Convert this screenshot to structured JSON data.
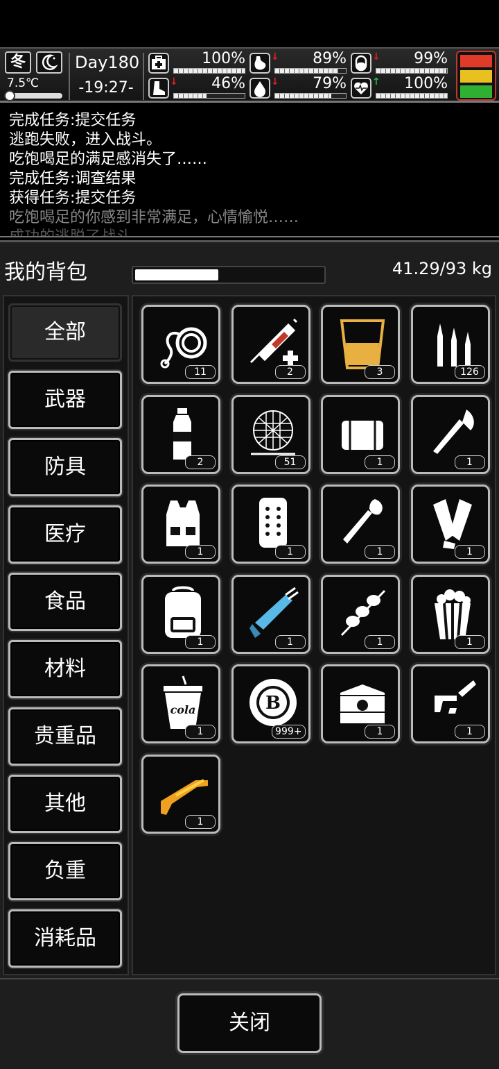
{
  "status": {
    "season": "冬",
    "temperature": "7.5℃",
    "day": "Day180",
    "time": "-19:27-",
    "stats": [
      {
        "name": "health",
        "icon": "medkit-icon",
        "value": "100%",
        "fill": 100,
        "trend": ""
      },
      {
        "name": "hunger",
        "icon": "stomach-icon",
        "value": "89%",
        "fill": 89,
        "trend": "down"
      },
      {
        "name": "medicine",
        "icon": "pill-icon",
        "value": "99%",
        "fill": 99,
        "trend": "down"
      },
      {
        "name": "stamina",
        "icon": "boot-icon",
        "value": "46%",
        "fill": 46,
        "trend": "down"
      },
      {
        "name": "thirst",
        "icon": "water-drop-icon",
        "value": "79%",
        "fill": 79,
        "trend": "down"
      },
      {
        "name": "mood",
        "icon": "heart-icon",
        "value": "100%",
        "fill": 100,
        "trend": "up"
      }
    ],
    "signal_colors": [
      "#e03a2a",
      "#e8c020",
      "#30b030"
    ]
  },
  "log": [
    "完成任务:提交任务",
    "逃跑失败，进入战斗。",
    "吃饱喝足的满足感消失了……",
    "完成任务:调查结果",
    "获得任务:提交任务",
    "吃饱喝足的你感到非常满足，心情愉悦……",
    "成功的逃脱了战斗"
  ],
  "inventory": {
    "title": "我的背包",
    "weight": "41.29/93 kg",
    "weight_fill": 0.444,
    "categories": [
      "全部",
      "武器",
      "防具",
      "医疗",
      "食品",
      "材料",
      "贵重品",
      "其他",
      "负重",
      "消耗品"
    ],
    "items": [
      {
        "icon": "rope-icon",
        "count": "11"
      },
      {
        "icon": "syringe-icon",
        "count": "2"
      },
      {
        "icon": "drink-cup-icon",
        "count": "3"
      },
      {
        "icon": "bullets-icon",
        "count": "126"
      },
      {
        "icon": "water-bottle-icon",
        "count": "2"
      },
      {
        "icon": "net-icon",
        "count": "51"
      },
      {
        "icon": "cloth-bale-icon",
        "count": "1"
      },
      {
        "icon": "axe-icon",
        "count": "1"
      },
      {
        "icon": "vest-icon",
        "count": "1"
      },
      {
        "icon": "riot-shield-icon",
        "count": "1"
      },
      {
        "icon": "shovel-icon",
        "count": "1"
      },
      {
        "icon": "leg-guards-icon",
        "count": "1"
      },
      {
        "icon": "backpack-icon",
        "count": "1"
      },
      {
        "icon": "minigun-icon",
        "count": "1"
      },
      {
        "icon": "skewer-icon",
        "count": "1"
      },
      {
        "icon": "popcorn-icon",
        "count": "1"
      },
      {
        "icon": "cola-cup-icon",
        "count": "1",
        "label": "cola"
      },
      {
        "icon": "coin-icon",
        "count": "999+"
      },
      {
        "icon": "chest-icon",
        "count": "1"
      },
      {
        "icon": "gun-parts-icon",
        "count": "1"
      },
      {
        "icon": "golden-rifle-icon",
        "count": "1"
      }
    ]
  },
  "close_label": "关闭"
}
